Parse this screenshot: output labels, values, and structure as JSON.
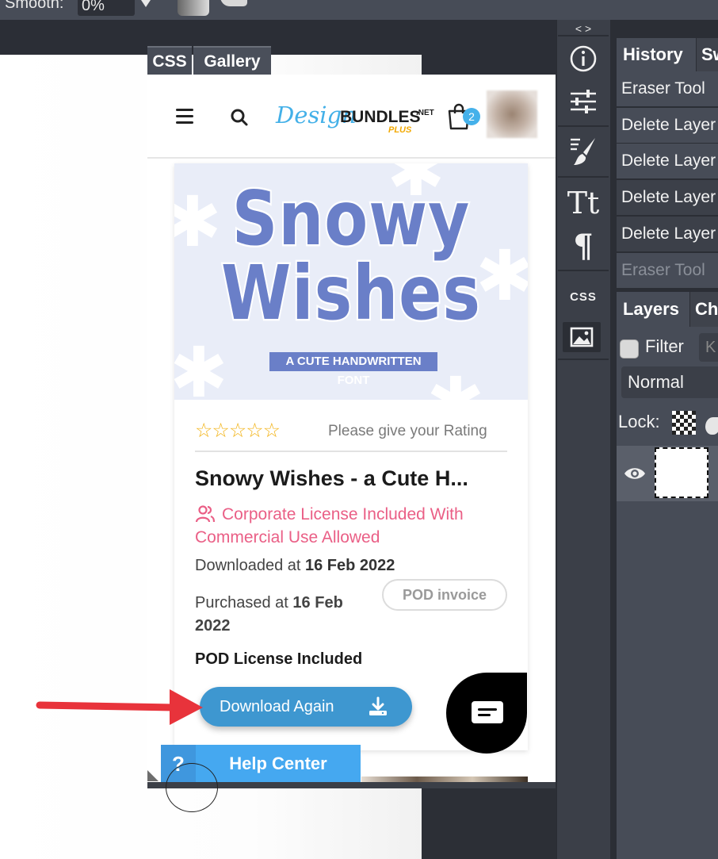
{
  "toolbar": {
    "smooth_label": "Smooth:",
    "smooth_value": "0%"
  },
  "panel_tabs": {
    "css": "CSS",
    "gallery": "Gallery"
  },
  "site": {
    "logo": {
      "design": "Design",
      "bundles": "BUNDLES",
      "net": ".NET",
      "plus": "PLUS"
    },
    "cart_count": "2",
    "product": {
      "art_line1": "Snowy",
      "art_line2": "Wishes",
      "art_banner": "A CUTE HANDWRITTEN FONT",
      "stars": "☆☆☆☆☆",
      "rating_prompt": "Please give your Rating",
      "title": "Snowy Wishes - a Cute H...",
      "license": "Corporate License Included With Commercial Use Allowed",
      "downloaded_label": "Downloaded at ",
      "downloaded_date": "16 Feb 2022",
      "purchased_label": "Purchased at ",
      "purchased_date": "16 Feb 2022",
      "pod_invoice": "POD invoice",
      "pod_license": "POD License Included",
      "download_again": "Download Again"
    },
    "help_center": {
      "icon": "?",
      "label": "Help Center"
    }
  },
  "tools": {
    "collapse": "< >",
    "items": [
      "info-icon",
      "adjustments-icon",
      "brush-settings-icon",
      "text-icon",
      "paragraph-icon",
      "css-icon",
      "gallery-icon"
    ],
    "css_label": "CSS"
  },
  "history": {
    "tab": "History",
    "tab2": "Sw",
    "items": [
      "Eraser Tool",
      "Delete Layer",
      "Delete Layer",
      "Delete Layer",
      "Delete Layer",
      "Eraser Tool"
    ]
  },
  "layers": {
    "tab": "Layers",
    "tab2": "Ch",
    "filter_label": "Filter",
    "filter_placeholder": "K",
    "blend_mode": "Normal",
    "lock_label": "Lock:"
  },
  "colors": {
    "accent_blue": "#3e97d0",
    "license_pink": "#ea5f86",
    "star_gold": "#f2b317",
    "arrow_red": "#e8333b"
  }
}
